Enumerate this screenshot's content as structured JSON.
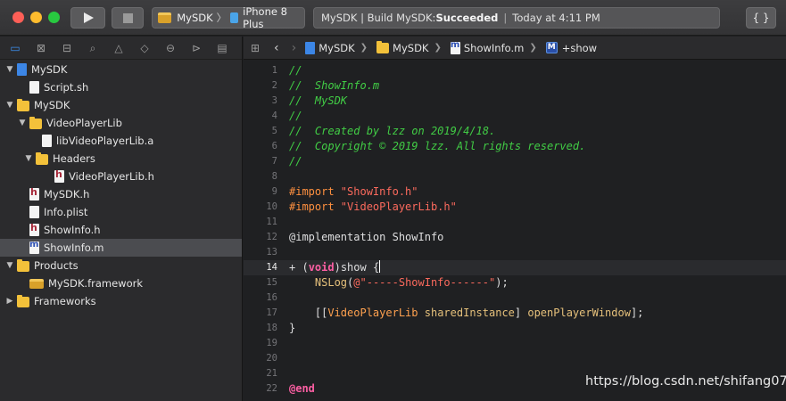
{
  "toolbar": {
    "scheme_name": "MySDK",
    "scheme_separator": "〉",
    "device_name": "iPhone 8 Plus",
    "status_prefix": "MySDK | Build MySDK: ",
    "status_result": "Succeeded",
    "status_separator": "|",
    "status_time": "Today at 4:11 PM",
    "braces_label": "{ }"
  },
  "navigator": {
    "tab_icons": [
      "folder-icon",
      "x-box-icon",
      "hierarchy-icon",
      "search-icon",
      "warning-icon",
      "diamond-icon",
      "test-icon",
      "breakpoint-icon",
      "message-icon"
    ],
    "rows": [
      {
        "label": "MySDK",
        "icon": "project",
        "indent": 0,
        "disclosure": "▼"
      },
      {
        "label": "Script.sh",
        "icon": "file",
        "indent": 1,
        "disclosure": ""
      },
      {
        "label": "MySDK",
        "icon": "folder",
        "indent": 0,
        "disclosure": "▼"
      },
      {
        "label": "VideoPlayerLib",
        "icon": "folder",
        "indent": 1,
        "disclosure": "▼"
      },
      {
        "label": "libVideoPlayerLib.a",
        "icon": "archive",
        "indent": 2,
        "disclosure": ""
      },
      {
        "label": "Headers",
        "icon": "folder",
        "indent": 1.5,
        "disclosure": "▼"
      },
      {
        "label": "VideoPlayerLib.h",
        "icon": "hfile",
        "indent": 3,
        "disclosure": ""
      },
      {
        "label": "MySDK.h",
        "icon": "hfile",
        "indent": 1,
        "disclosure": ""
      },
      {
        "label": "Info.plist",
        "icon": "file",
        "indent": 1,
        "disclosure": ""
      },
      {
        "label": "ShowInfo.h",
        "icon": "hfile",
        "indent": 1,
        "disclosure": ""
      },
      {
        "label": "ShowInfo.m",
        "icon": "mfile",
        "indent": 1,
        "disclosure": "",
        "selected": true
      },
      {
        "label": "Products",
        "icon": "folder",
        "indent": 0,
        "disclosure": "▼"
      },
      {
        "label": "MySDK.framework",
        "icon": "framework",
        "indent": 1,
        "disclosure": ""
      },
      {
        "label": "Frameworks",
        "icon": "folder",
        "indent": 0,
        "disclosure": "▶"
      }
    ]
  },
  "jumpbar": {
    "crumbs": [
      "MySDK",
      "MySDK",
      "ShowInfo.m"
    ],
    "method_badge": "M",
    "method": "+show"
  },
  "code": {
    "current_line": 14,
    "lines": [
      {
        "n": "1",
        "t": "//",
        "k": "comment"
      },
      {
        "n": "2",
        "t": "//  ShowInfo.m",
        "k": "comment"
      },
      {
        "n": "3",
        "t": "//  MySDK",
        "k": "comment"
      },
      {
        "n": "4",
        "t": "//",
        "k": "comment"
      },
      {
        "n": "5",
        "t": "//  Created by lzz on 2019/4/18.",
        "k": "comment"
      },
      {
        "n": "6",
        "t": "//  Copyright © 2019 lzz. All rights reserved.",
        "k": "comment"
      },
      {
        "n": "7",
        "t": "//",
        "k": "comment"
      },
      {
        "n": "8",
        "t": "",
        "k": "plain"
      },
      {
        "n": "9",
        "t": "#import \"ShowInfo.h\"",
        "k": "import",
        "pre": "#import ",
        "str": "\"ShowInfo.h\""
      },
      {
        "n": "10",
        "t": "#import \"VideoPlayerLib.h\"",
        "k": "import",
        "pre": "#import ",
        "str": "\"VideoPlayerLib.h\""
      },
      {
        "n": "11",
        "t": "",
        "k": "plain"
      },
      {
        "n": "12",
        "t": "@implementation ShowInfo",
        "k": "plain"
      },
      {
        "n": "13",
        "t": "",
        "k": "plain"
      },
      {
        "n": "14",
        "t": "+ (void)show {",
        "k": "method"
      },
      {
        "n": "15",
        "t": "    NSLog(@\"-----ShowInfo------\");",
        "k": "nslog"
      },
      {
        "n": "16",
        "t": "",
        "k": "plain"
      },
      {
        "n": "17",
        "t": "    [[VideoPlayerLib sharedInstance] openPlayerWindow];",
        "k": "call"
      },
      {
        "n": "18",
        "t": "}",
        "k": "plain"
      },
      {
        "n": "19",
        "t": "",
        "k": "plain"
      },
      {
        "n": "20",
        "t": "",
        "k": "plain"
      },
      {
        "n": "21",
        "t": "",
        "k": "plain"
      },
      {
        "n": "22",
        "t": "@end",
        "k": "end"
      }
    ]
  },
  "watermark": "https://blog.csdn.net/shifang07",
  "colors": {
    "comment": "#41cc45",
    "preprocessor": "#fd8f3f",
    "string": "#fc6a5d",
    "keyword": "#fc5fa3",
    "selection": "#4b4c50"
  }
}
